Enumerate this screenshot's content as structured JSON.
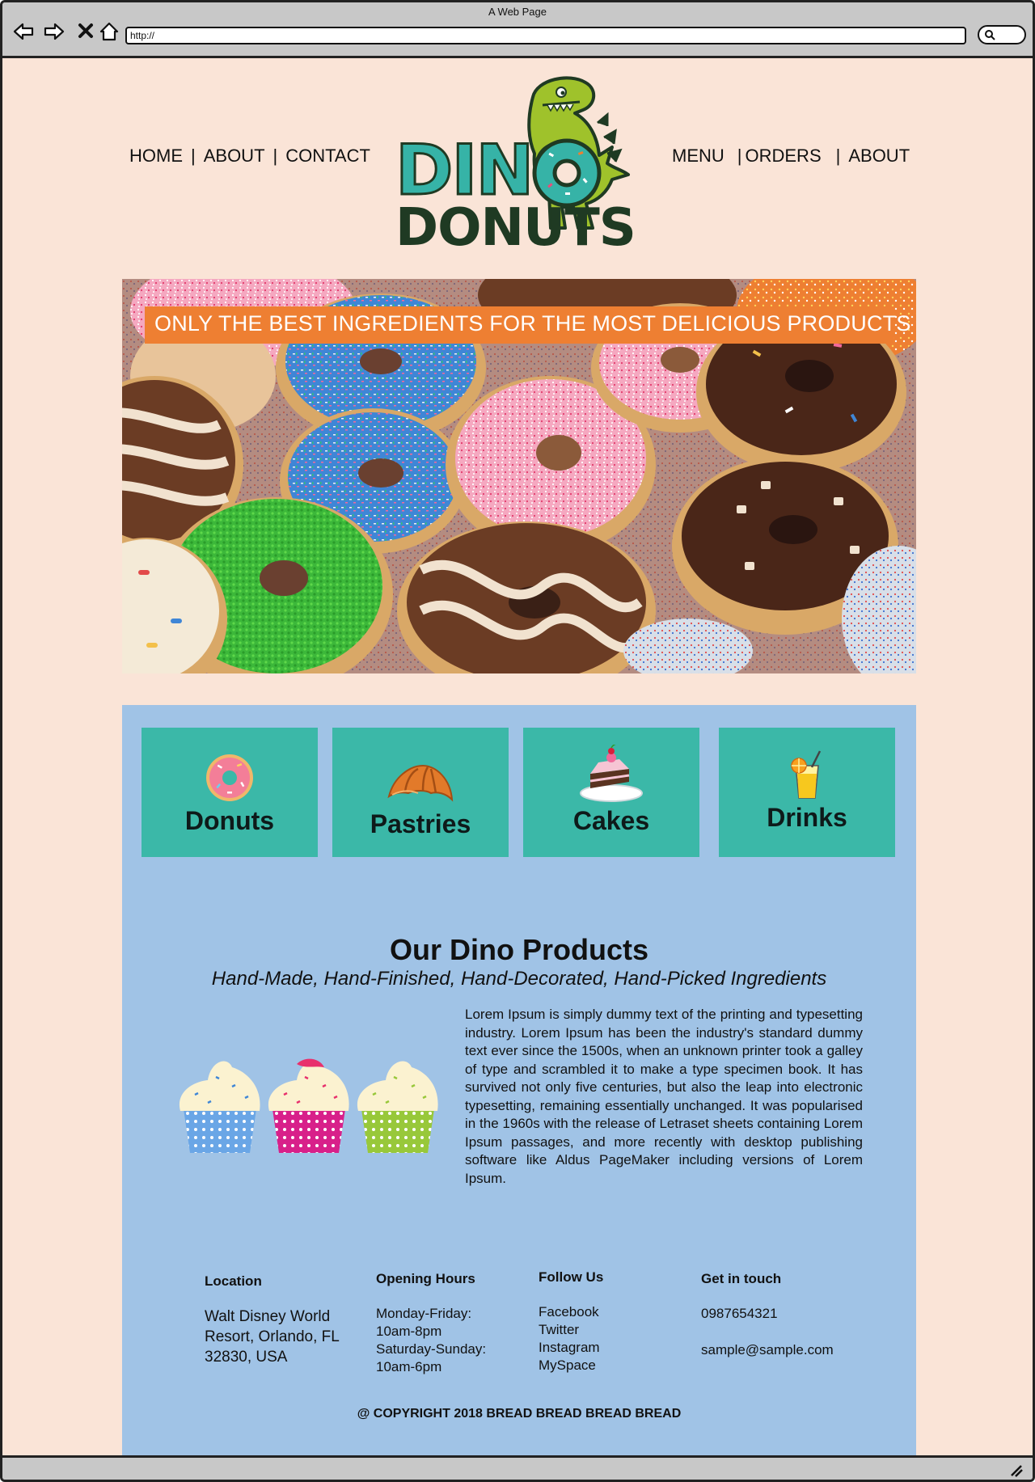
{
  "browser": {
    "window_title": "A Web Page",
    "url": "http://"
  },
  "nav_left": [
    "HOME",
    "ABOUT",
    "CONTACT"
  ],
  "nav_right": [
    "MENU",
    "ORDERS",
    "ABOUT"
  ],
  "logo": {
    "line1": "DINO",
    "line2": "DONUTS"
  },
  "hero": {
    "banner": "ONLY THE BEST INGREDIENTS FOR THE MOST DELICIOUS PRODUCTS"
  },
  "categories": [
    {
      "label": "Donuts",
      "icon": "donut-icon"
    },
    {
      "label": "Pastries",
      "icon": "croissant-icon"
    },
    {
      "label": "Cakes",
      "icon": "cake-icon"
    },
    {
      "label": "Drinks",
      "icon": "drink-icon"
    }
  ],
  "products": {
    "title": "Our Dino Products",
    "subtitle": "Hand-Made, Hand-Finished, Hand-Decorated, Hand-Picked Ingredients",
    "body": "Lorem Ipsum is simply dummy text of the printing and typesetting industry. Lorem Ipsum has been the industry's standard dummy text ever since the 1500s, when an unknown printer took a galley of type and scrambled it to make a type specimen book. It has survived not only five centuries, but also the leap into electronic typesetting, remaining essentially unchanged. It was popularised in the 1960s with the release of Letraset sheets containing Lorem Ipsum passages, and more recently with desktop publishing software like Aldus PageMaker including versions of Lorem Ipsum."
  },
  "footer": {
    "location": {
      "heading": "Location",
      "lines": [
        "Walt Disney World",
        "Resort, Orlando, FL",
        "32830, USA"
      ]
    },
    "hours": {
      "heading": "Opening Hours",
      "lines": [
        "Monday-Friday:",
        "10am-8pm",
        "Saturday-Sunday:",
        "10am-6pm"
      ]
    },
    "follow": {
      "heading": "Follow Us",
      "links": [
        "Facebook",
        "Twitter",
        "Instagram",
        "MySpace"
      ]
    },
    "contact": {
      "heading": "Get in touch",
      "phone": "0987654321",
      "email": "sample@sample.com"
    },
    "copyright": "@ COPYRIGHT 2018 BREAD BREAD BREAD BREAD"
  },
  "colors": {
    "page_bg": "#fae4d7",
    "banner": "#ee7f32",
    "section_bg": "#a0c3e6",
    "tile": "#3bb8a8",
    "logo_teal": "#36b3a7",
    "logo_dark": "#1f3a23",
    "dino": "#9fc22b"
  }
}
